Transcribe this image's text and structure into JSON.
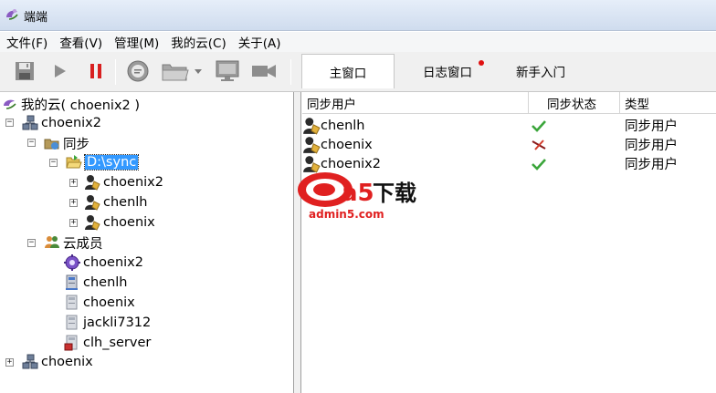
{
  "window": {
    "title": "端端"
  },
  "menu": [
    "文件(F)",
    "查看(V)",
    "管理(M)",
    "我的云(C)",
    "关于(A)"
  ],
  "toolbar": {
    "buttons": [
      "save-icon",
      "play-icon",
      "pause-icon",
      "chat-icon",
      "folder-icon",
      "monitor-icon",
      "camera-icon"
    ],
    "colors": {
      "pause": "#d81f1f"
    }
  },
  "tabs": [
    {
      "label": "主窗口",
      "active": true
    },
    {
      "label": "日志窗口",
      "badge": true
    },
    {
      "label": "新手入门"
    }
  ],
  "tree": {
    "root": "我的云( choenix2 )",
    "hosts": [
      {
        "label": "choenix2",
        "sync_label": "同步",
        "folder": "D:\\sync",
        "folder_users": [
          "choenix2",
          "chenlh",
          "choenix"
        ],
        "members_label": "云成员",
        "members": [
          "choenix2",
          "chenlh",
          "choenix",
          "jackli7312",
          "clh_server"
        ]
      },
      {
        "label": "choenix"
      }
    ]
  },
  "table": {
    "columns": [
      "同步用户",
      "同步状态",
      "类型"
    ],
    "rows": [
      {
        "user": "chenlh",
        "status": "ok",
        "type": "同步用户"
      },
      {
        "user": "choenix",
        "status": "error",
        "type": "同步用户"
      },
      {
        "user": "choenix2",
        "status": "ok",
        "type": "同步用户"
      }
    ]
  },
  "watermark": {
    "brand": "a5",
    "cn": "下载",
    "domain": "admin5.com"
  }
}
